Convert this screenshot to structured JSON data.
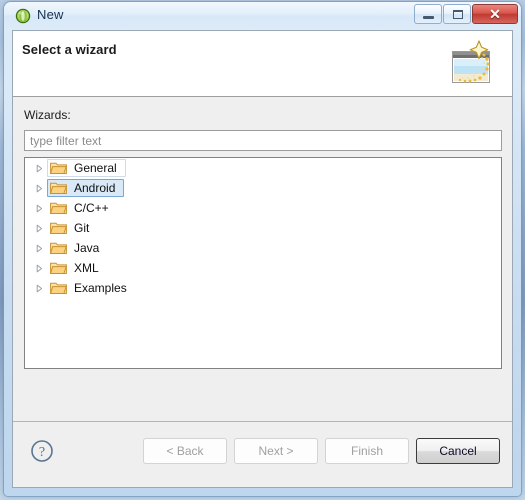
{
  "window": {
    "title": "New",
    "icon": "eclipse-new-icon",
    "controls": {
      "minimize_label": "─",
      "maximize_label": "□",
      "close_label": "✕"
    }
  },
  "header": {
    "title": "Select a wizard",
    "description": "",
    "icon": "wizard-sparkle-icon"
  },
  "body": {
    "wizards_label": "Wizards:",
    "filter": {
      "value": "",
      "placeholder": "type filter text"
    },
    "tree": {
      "items": [
        {
          "label": "General",
          "expanded": false,
          "selected": false,
          "focused": true,
          "icon": "folder-icon"
        },
        {
          "label": "Android",
          "expanded": false,
          "selected": true,
          "focused": false,
          "icon": "folder-icon"
        },
        {
          "label": "C/C++",
          "expanded": false,
          "selected": false,
          "focused": false,
          "icon": "folder-icon"
        },
        {
          "label": "Git",
          "expanded": false,
          "selected": false,
          "focused": false,
          "icon": "folder-icon"
        },
        {
          "label": "Java",
          "expanded": false,
          "selected": false,
          "focused": false,
          "icon": "folder-icon"
        },
        {
          "label": "XML",
          "expanded": false,
          "selected": false,
          "focused": false,
          "icon": "folder-icon"
        },
        {
          "label": "Examples",
          "expanded": false,
          "selected": false,
          "focused": false,
          "icon": "folder-icon"
        }
      ]
    }
  },
  "footer": {
    "help_icon": "question-mark-icon",
    "buttons": [
      {
        "label": "< Back",
        "state": "disabled"
      },
      {
        "label": "Next >",
        "state": "disabled"
      },
      {
        "label": "Finish",
        "state": "disabled"
      },
      {
        "label": "Cancel",
        "state": "default"
      }
    ]
  },
  "colors": {
    "selection_fill": "#d9e9f8",
    "selection_border": "#7ba7d4",
    "dialog_bg": "#efefef",
    "header_bg": "#ffffff",
    "close_button": "#bf3a31",
    "folder": "#f5c46a"
  }
}
